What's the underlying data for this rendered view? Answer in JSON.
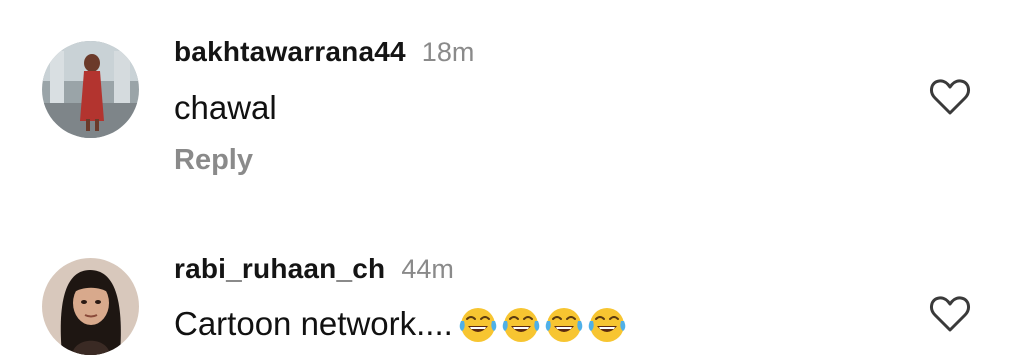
{
  "comments": [
    {
      "username": "bakhtawarrana44",
      "time": "18m",
      "text": "chawal",
      "reply_label": "Reply",
      "avatar": "user-photo-avatar",
      "like_icon": "heart-outline-icon"
    },
    {
      "username": "rabi_ruhaan_ch",
      "time": "44m",
      "text": "Cartoon network....",
      "emojis": [
        "tears-of-joy-emoji",
        "tears-of-joy-emoji",
        "tears-of-joy-emoji",
        "tears-of-joy-emoji"
      ],
      "avatar": "user-photo-avatar",
      "like_icon": "heart-outline-icon"
    }
  ],
  "colors": {
    "text": "#111111",
    "muted": "#8a8a8a",
    "emoji": "#f7c531"
  }
}
